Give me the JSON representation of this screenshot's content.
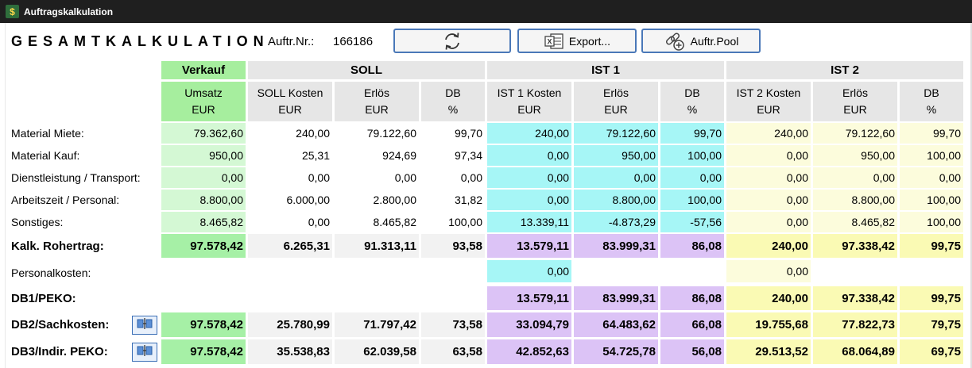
{
  "window": {
    "title": "Auftragskalkulation"
  },
  "header": {
    "title": "GESAMTKALKULATION",
    "order_label": "Auftr.Nr.:",
    "order_number": "166186"
  },
  "toolbar": {
    "refresh_icon": "refresh-icon",
    "export_label": "Export...",
    "pool_label": "Auftr.Pool"
  },
  "groups": {
    "verkauf": "Verkauf",
    "soll": "SOLL",
    "ist1": "IST 1",
    "ist2": "IST 2"
  },
  "columns": [
    {
      "l1": "Umsatz",
      "l2": "EUR"
    },
    {
      "l1": "SOLL Kosten",
      "l2": "EUR"
    },
    {
      "l1": "Erlös",
      "l2": "EUR"
    },
    {
      "l1": "DB",
      "l2": "%"
    },
    {
      "l1": "IST 1 Kosten",
      "l2": "EUR"
    },
    {
      "l1": "Erlös",
      "l2": "EUR"
    },
    {
      "l1": "DB",
      "l2": "%"
    },
    {
      "l1": "IST 2 Kosten",
      "l2": "EUR"
    },
    {
      "l1": "Erlös",
      "l2": "EUR"
    },
    {
      "l1": "DB",
      "l2": "%"
    }
  ],
  "rows": [
    {
      "label": "Material Miete:",
      "values": [
        "79.362,60",
        "240,00",
        "79.122,60",
        "99,70",
        "240,00",
        "79.122,60",
        "99,70",
        "240,00",
        "79.122,60",
        "99,70"
      ]
    },
    {
      "label": "Material Kauf:",
      "values": [
        "950,00",
        "25,31",
        "924,69",
        "97,34",
        "0,00",
        "950,00",
        "100,00",
        "0,00",
        "950,00",
        "100,00"
      ]
    },
    {
      "label": "Dienstleistung / Transport:",
      "values": [
        "0,00",
        "0,00",
        "0,00",
        "0,00",
        "0,00",
        "0,00",
        "0,00",
        "0,00",
        "0,00",
        "0,00"
      ]
    },
    {
      "label": "Arbeitszeit / Personal:",
      "values": [
        "8.800,00",
        "6.000,00",
        "2.800,00",
        "31,82",
        "0,00",
        "8.800,00",
        "100,00",
        "0,00",
        "8.800,00",
        "100,00"
      ]
    },
    {
      "label": "Sonstiges:",
      "values": [
        "8.465,82",
        "0,00",
        "8.465,82",
        "100,00",
        "13.339,11",
        "-4.873,29",
        "-57,56",
        "0,00",
        "8.465,82",
        "100,00"
      ]
    }
  ],
  "rohertrag": {
    "label": "Kalk. Rohertrag:",
    "values": [
      "97.578,42",
      "6.265,31",
      "91.313,11",
      "93,58",
      "13.579,11",
      "83.999,31",
      "86,08",
      "240,00",
      "97.338,42",
      "99,75"
    ]
  },
  "personalkosten": {
    "label": "Personalkosten:",
    "ist1": "0,00",
    "ist2": "0,00"
  },
  "db1": {
    "label": "DB1/PEKO:",
    "values": [
      "13.579,11",
      "83.999,31",
      "86,08",
      "240,00",
      "97.338,42",
      "99,75"
    ]
  },
  "db2": {
    "label": "DB2/Sachkosten:",
    "values": [
      "97.578,42",
      "25.780,99",
      "71.797,42",
      "73,58",
      "33.094,79",
      "64.483,62",
      "66,08",
      "19.755,68",
      "77.822,73",
      "79,75"
    ]
  },
  "db3": {
    "label": "DB3/Indir. PEKO:",
    "values": [
      "97.578,42",
      "35.538,83",
      "62.039,58",
      "63,58",
      "42.852,63",
      "54.725,78",
      "56,08",
      "29.513,52",
      "68.064,89",
      "69,75"
    ]
  },
  "colors": {
    "verkauf_light": "#d4f8d4",
    "verkauf_bold": "#a6f0a6",
    "verkauf_header": "#a6ee9e",
    "soll": "#f2f2f2",
    "ist1_light": "#a6f6f6",
    "ist1_bold": "#dcc3f6",
    "ist2_light": "#fcfcdc",
    "ist2_bold": "#fafab4",
    "accent": "#4a78b8"
  }
}
